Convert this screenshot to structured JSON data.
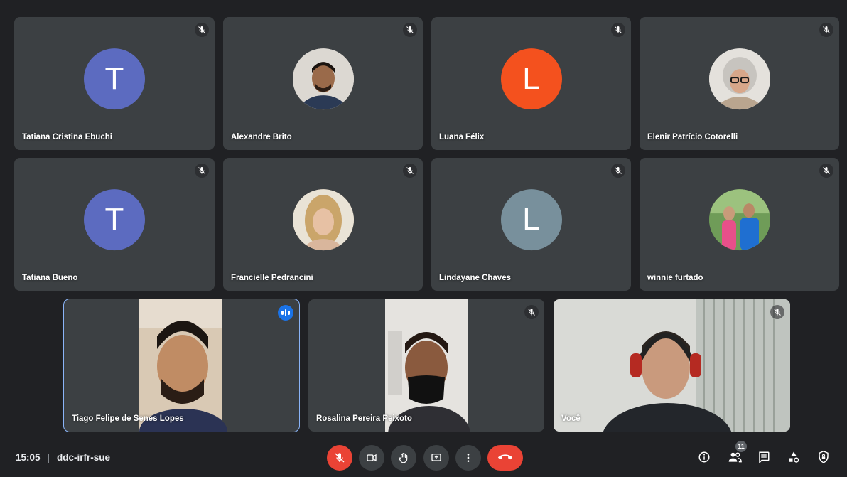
{
  "participants": [
    {
      "name": "Tatiana Cristina Ebuchi",
      "initial": "T",
      "avatar_color": "#5c6bc0",
      "muted": true
    },
    {
      "name": "Alexandre Brito",
      "initial": "",
      "avatar_color": "#c9c9c9",
      "muted": true,
      "photo": true
    },
    {
      "name": "Luana Félix",
      "initial": "L",
      "avatar_color": "#f4511e",
      "muted": true
    },
    {
      "name": "Elenir Patrício Cotorelli",
      "initial": "",
      "avatar_color": "#d7d3ce",
      "muted": true,
      "photo": true
    },
    {
      "name": "Tatiana Bueno",
      "initial": "T",
      "avatar_color": "#5c6bc0",
      "muted": true
    },
    {
      "name": "Francielle Pedrancini",
      "initial": "",
      "avatar_color": "#c7ab8c",
      "muted": true,
      "photo": true
    },
    {
      "name": "Lindayane Chaves",
      "initial": "L",
      "avatar_color": "#78909c",
      "muted": true
    },
    {
      "name": "winnie furtado",
      "initial": "",
      "avatar_color": "#5a8a4a",
      "muted": true,
      "photo": true
    }
  ],
  "video_tiles": [
    {
      "name": "Tiago Felipe de Senes Lopes",
      "speaking": true
    },
    {
      "name": "Rosalina Pereira Peixoto",
      "muted": true
    },
    {
      "name": "Você",
      "muted": true
    }
  ],
  "meeting": {
    "time": "15:05",
    "code": "ddc-irfr-sue"
  },
  "controls": {
    "participant_count": "11"
  },
  "colors": {
    "background": "#202124",
    "tile": "#3c4043",
    "danger": "#ea4335",
    "accent": "#1a73e8"
  }
}
